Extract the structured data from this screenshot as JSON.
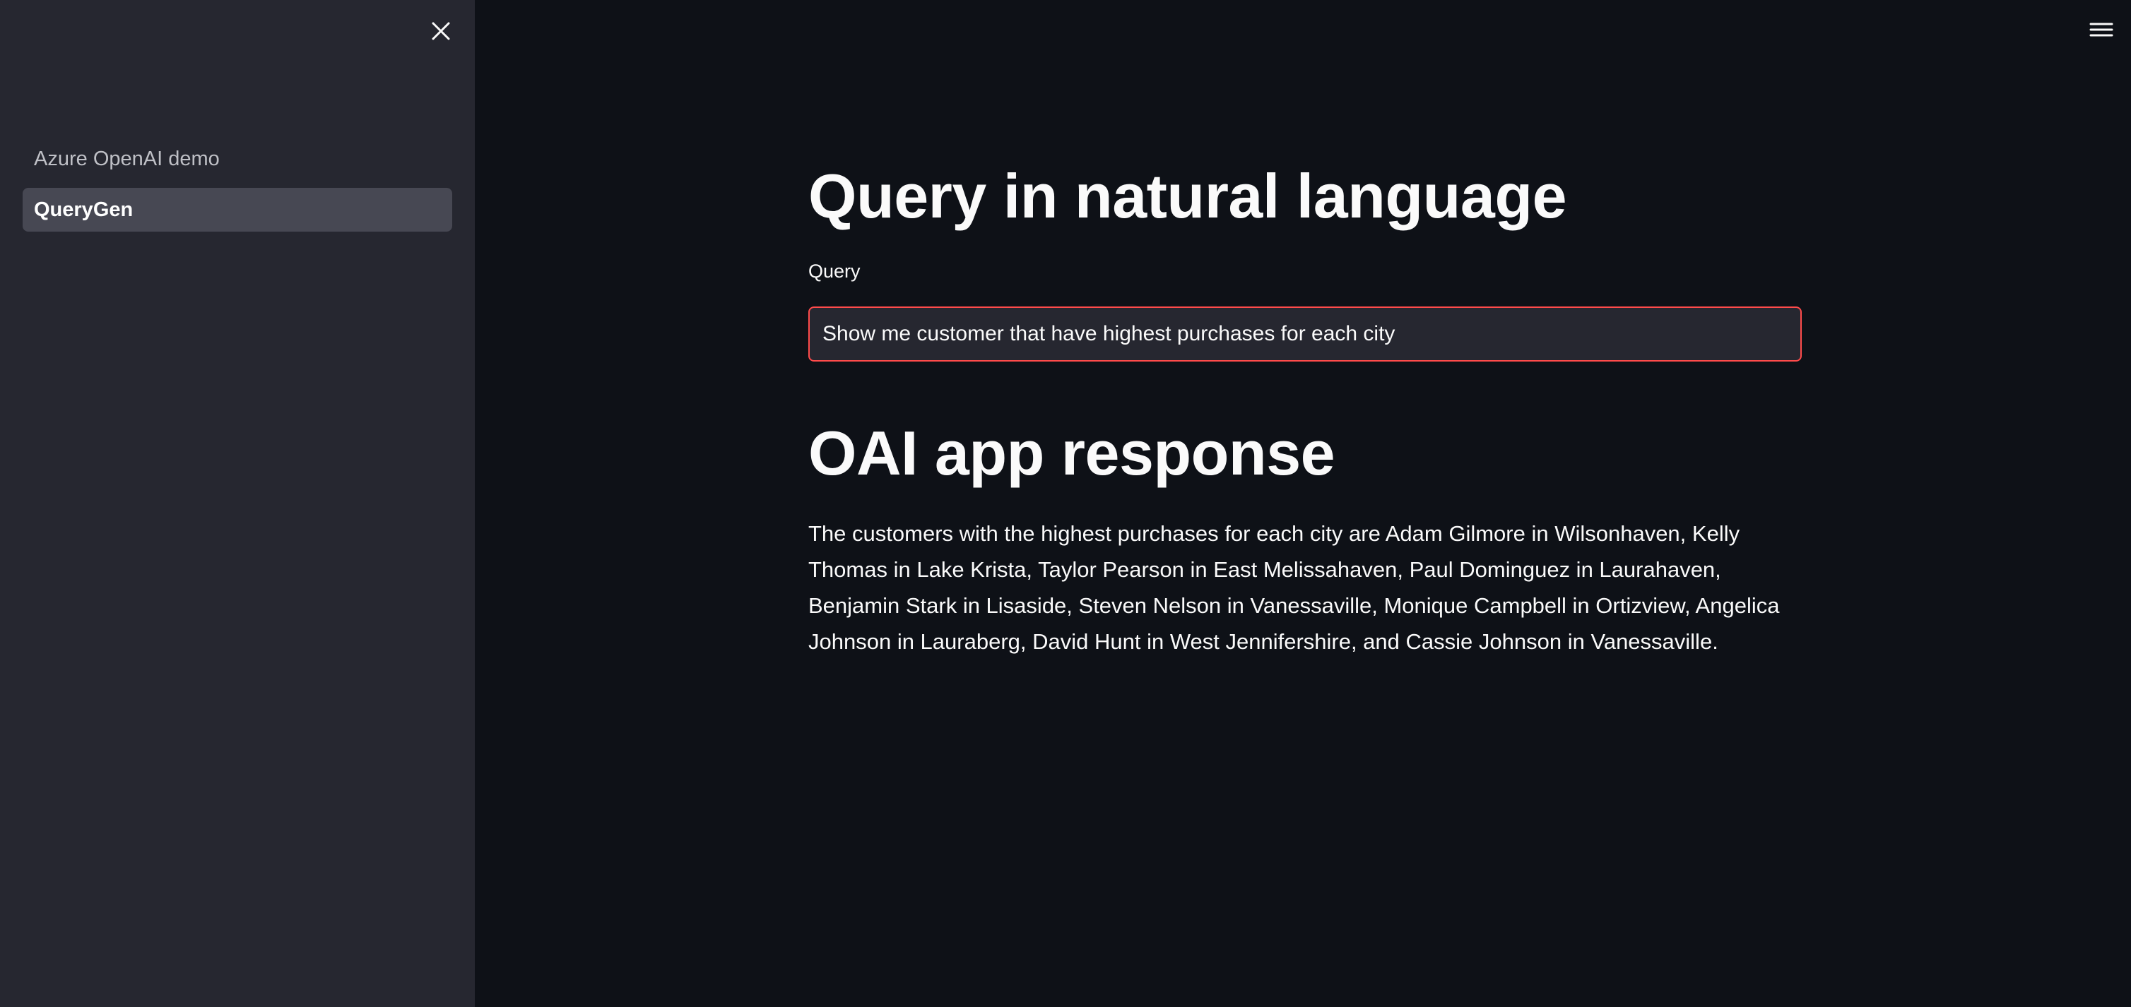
{
  "sidebar": {
    "close_icon": "close-icon",
    "items": [
      {
        "label": "Azure OpenAI demo",
        "active": false
      },
      {
        "label": "QueryGen",
        "active": true
      }
    ]
  },
  "header": {
    "menu_icon": "hamburger-menu-icon"
  },
  "main": {
    "title": "Query in natural language",
    "query": {
      "label": "Query",
      "value": "Show me customer that have highest purchases for each city"
    },
    "response_heading": "OAI app response",
    "response_text": "The customers with the highest purchases for each city are Adam Gilmore in Wilsonhaven, Kelly Thomas in Lake Krista, Taylor Pearson in East Melissahaven, Paul Dominguez in Laurahaven, Benjamin Stark in Lisaside, Steven Nelson in Vanessaville, Monique Campbell in Ortizview, Angelica Johnson in Lauraberg, David Hunt in West Jennifershire, and Cassie Johnson in Vanessaville."
  },
  "colors": {
    "background": "#0e1117",
    "sidebar_bg": "#262730",
    "active_nav_bg": "#474853",
    "input_border": "#ff4b4b",
    "text": "#fafafa"
  }
}
